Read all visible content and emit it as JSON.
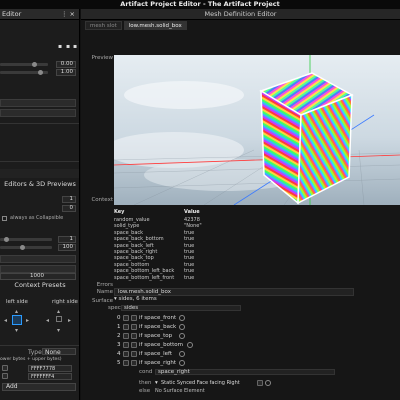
{
  "window": {
    "title": "Artifact Project Editor - The Artifact Project"
  },
  "left_panel": {
    "header": "Editor",
    "numbers": [
      "0.00",
      "1.00",
      "1",
      "0",
      "1",
      "100",
      "1000"
    ],
    "editors_title": "Editors & 3D Previews",
    "always_collapsible": "always as Collapsible",
    "context_presets": "Context Presets",
    "left_side": "left side",
    "right_side": "right side",
    "type_label": "Type",
    "type_value": "None",
    "list_caption": "ower bytes + upper bytes)",
    "list_values": [
      "FFFF7778",
      "FFFFFFF4"
    ],
    "add_button": "Add"
  },
  "main": {
    "header": "Mesh Definition Editor",
    "tabs": [
      "mesh slot",
      "low.mesh.solid_box"
    ],
    "preview_label": "Preview",
    "context_label": "Context",
    "table_headers": [
      "Key",
      "Value"
    ],
    "table_rows": [
      [
        "random_value",
        "42378"
      ],
      [
        "solid_type",
        "\"None\""
      ],
      [
        "space_back",
        "true"
      ],
      [
        "space_back_bottom",
        "true"
      ],
      [
        "space_back_left",
        "true"
      ],
      [
        "space_back_right",
        "true"
      ],
      [
        "space_back_top",
        "true"
      ],
      [
        "space_bottom",
        "true"
      ],
      [
        "space_bottom_left_back",
        "true"
      ],
      [
        "space_bottom_left_front",
        "true"
      ]
    ],
    "errors_label": "Errors",
    "name_label": "Name",
    "name_value": "low.mesh.solid_box",
    "surface_label": "Surface",
    "surface_value": "sides, 6 items",
    "spec_label": "spec",
    "spec_value": "sides",
    "sides": [
      {
        "index": "0",
        "label": "if space_front"
      },
      {
        "index": "1",
        "label": "if space_back"
      },
      {
        "index": "2",
        "label": "if space_top"
      },
      {
        "index": "3",
        "label": "if space_bottom"
      },
      {
        "index": "4",
        "label": "if space_left"
      },
      {
        "index": "5",
        "label": "if space_right"
      }
    ],
    "cond_label": "cond",
    "cond_value": "space_right",
    "then_label": "then",
    "then_value": "Static Synced Face facing Right",
    "else_label": "else",
    "else_value": "No Surface Element"
  }
}
